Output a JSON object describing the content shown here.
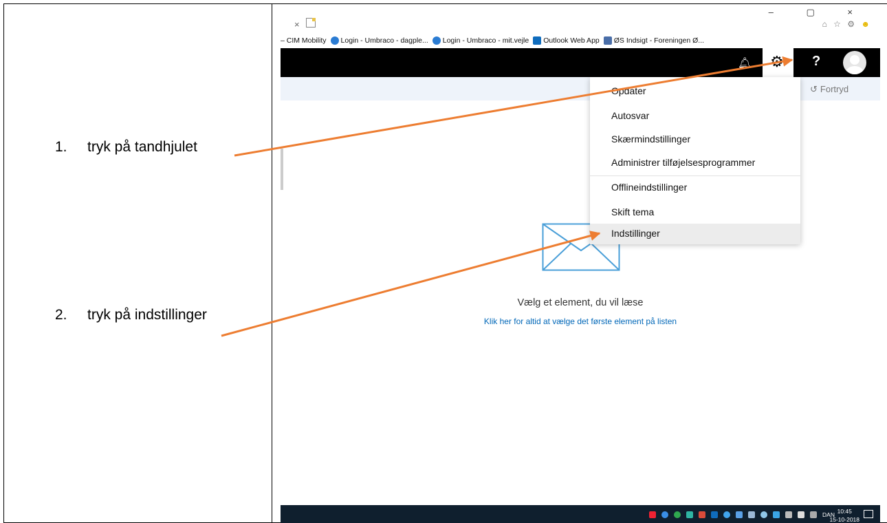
{
  "instructions": [
    {
      "number": "1.",
      "text": "tryk på tandhjulet"
    },
    {
      "number": "2.",
      "text": "tryk på indstillinger"
    }
  ],
  "browser": {
    "tab_close": "×",
    "window_controls": "– ▢ ×",
    "toolbar_icons": "⌂ ☆ ⚙",
    "favorites": [
      {
        "label": "– CIM Mobility",
        "icon": "none"
      },
      {
        "label": "Login - Umbraco - dagple...",
        "icon": "ie-icon"
      },
      {
        "label": "Login - Umbraco - mit.vejle",
        "icon": "ie-icon"
      },
      {
        "label": "Outlook Web App",
        "icon": "outlook-icon"
      },
      {
        "label": "ØS Indsigt - Foreningen Ø...",
        "icon": "os-icon"
      }
    ]
  },
  "topbar": {
    "help_label": "?"
  },
  "commandbar": {
    "undo_label": "Fortryd"
  },
  "settings_menu": {
    "items": [
      {
        "label": "Opdater"
      },
      {
        "label": "Autosvar"
      },
      {
        "label": "Skærmindstillinger"
      },
      {
        "label": "Administrer tilføjelsesprogrammer"
      },
      {
        "label": "Offlineindstillinger"
      },
      {
        "label": "Skift tema"
      },
      {
        "label": "Indstillinger",
        "highlighted": true
      }
    ]
  },
  "reading_pane": {
    "title": "Vælg et element, du vil læse",
    "link": "Klik her for altid at vælge det første element på listen"
  },
  "taskbar": {
    "language": "DAN",
    "time": "10:45",
    "date": "15-10-2018"
  },
  "colors": {
    "arrow": "#ed7d31",
    "link": "#0067b8",
    "topbar": "#000000",
    "commandbar": "#eef3fa",
    "mail_icon": "#4a9fd8"
  }
}
